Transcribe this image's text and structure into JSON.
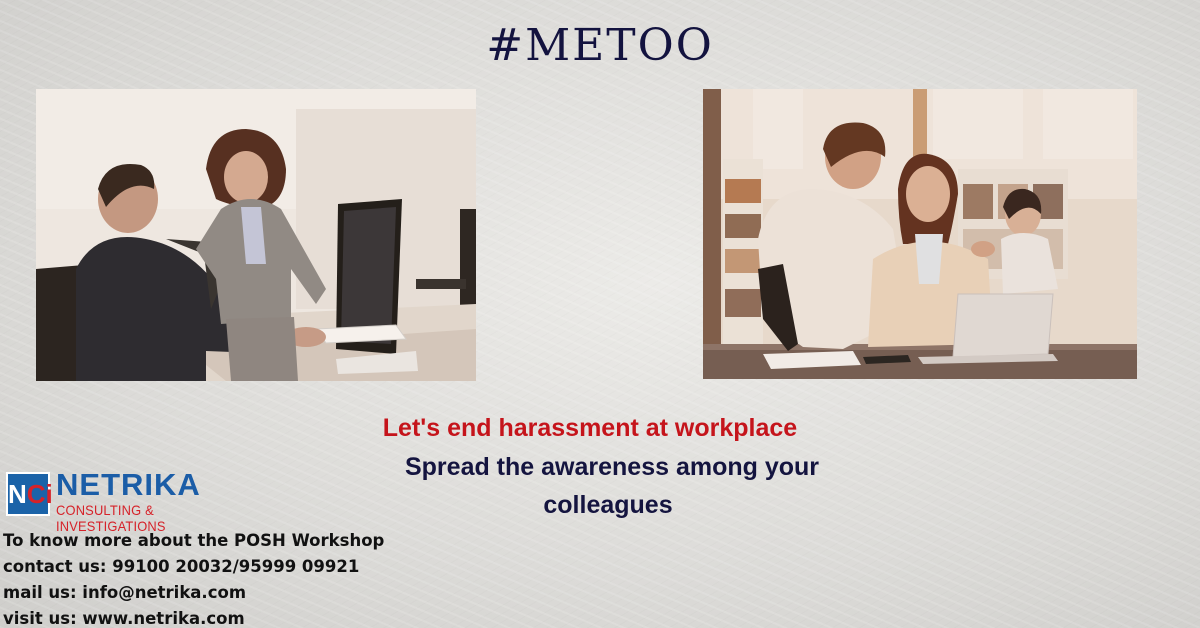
{
  "title": "#METOO",
  "images": {
    "left": {
      "description": "Woman in grey suit pulling the tie of a seated man at a computer desk"
    },
    "right": {
      "description": "Man leaning over a woman seated at a laptop in an office with bookshelves"
    }
  },
  "tagline": {
    "line1": "Let's end harassment at workplace",
    "line2": "Spread the awareness among your",
    "line3": "colleagues"
  },
  "logo": {
    "mark_left": "N",
    "mark_right": "Ci",
    "name": "NETRIKA",
    "subtitle": "CONSULTING & INVESTIGATIONS"
  },
  "contact": {
    "line1": "To know more about the POSH Workshop",
    "line2": "contact us: 99100 20032/95999 09921",
    "line3": "mail us: info@netrika.com",
    "line4": "visit us: www.netrika.com"
  },
  "colors": {
    "title": "#13133f",
    "highlight_red": "#c5141b",
    "navy": "#14143f",
    "brand_blue": "#1b5da7",
    "brand_red": "#d62229"
  }
}
